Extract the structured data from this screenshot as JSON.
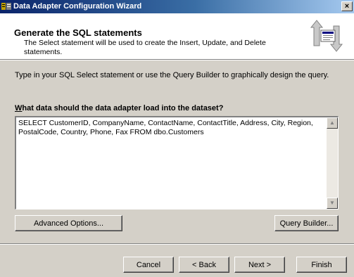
{
  "window": {
    "title": "Data Adapter Configuration Wizard",
    "close_label": "×"
  },
  "header": {
    "title": "Generate the SQL statements",
    "subtitle": "The Select statement will be used to create the Insert, Update, and Delete statements."
  },
  "instructions": "Type in your SQL Select statement or use the Query Builder to graphically design the query.",
  "question": {
    "first_letter": "W",
    "rest": "hat data should the data adapter load into the dataset?"
  },
  "sql_statement": "SELECT CustomerID, CompanyName, ContactName, ContactTitle, Address, City, Region, PostalCode, Country, Phone, Fax FROM dbo.Customers",
  "buttons": {
    "advanced_options": "Advanced Options...",
    "query_builder": "Query Builder...",
    "cancel": "Cancel",
    "back": "< Back",
    "next": "Next >",
    "finish": "Finish"
  },
  "colors": {
    "titlebar_start": "#0a246a",
    "titlebar_end": "#a6caf0",
    "dialog_face": "#d4d0c8"
  },
  "icons": [
    "app-icon",
    "close-icon",
    "wizard-arrows-icon",
    "scroll-up-icon",
    "scroll-down-icon"
  ]
}
